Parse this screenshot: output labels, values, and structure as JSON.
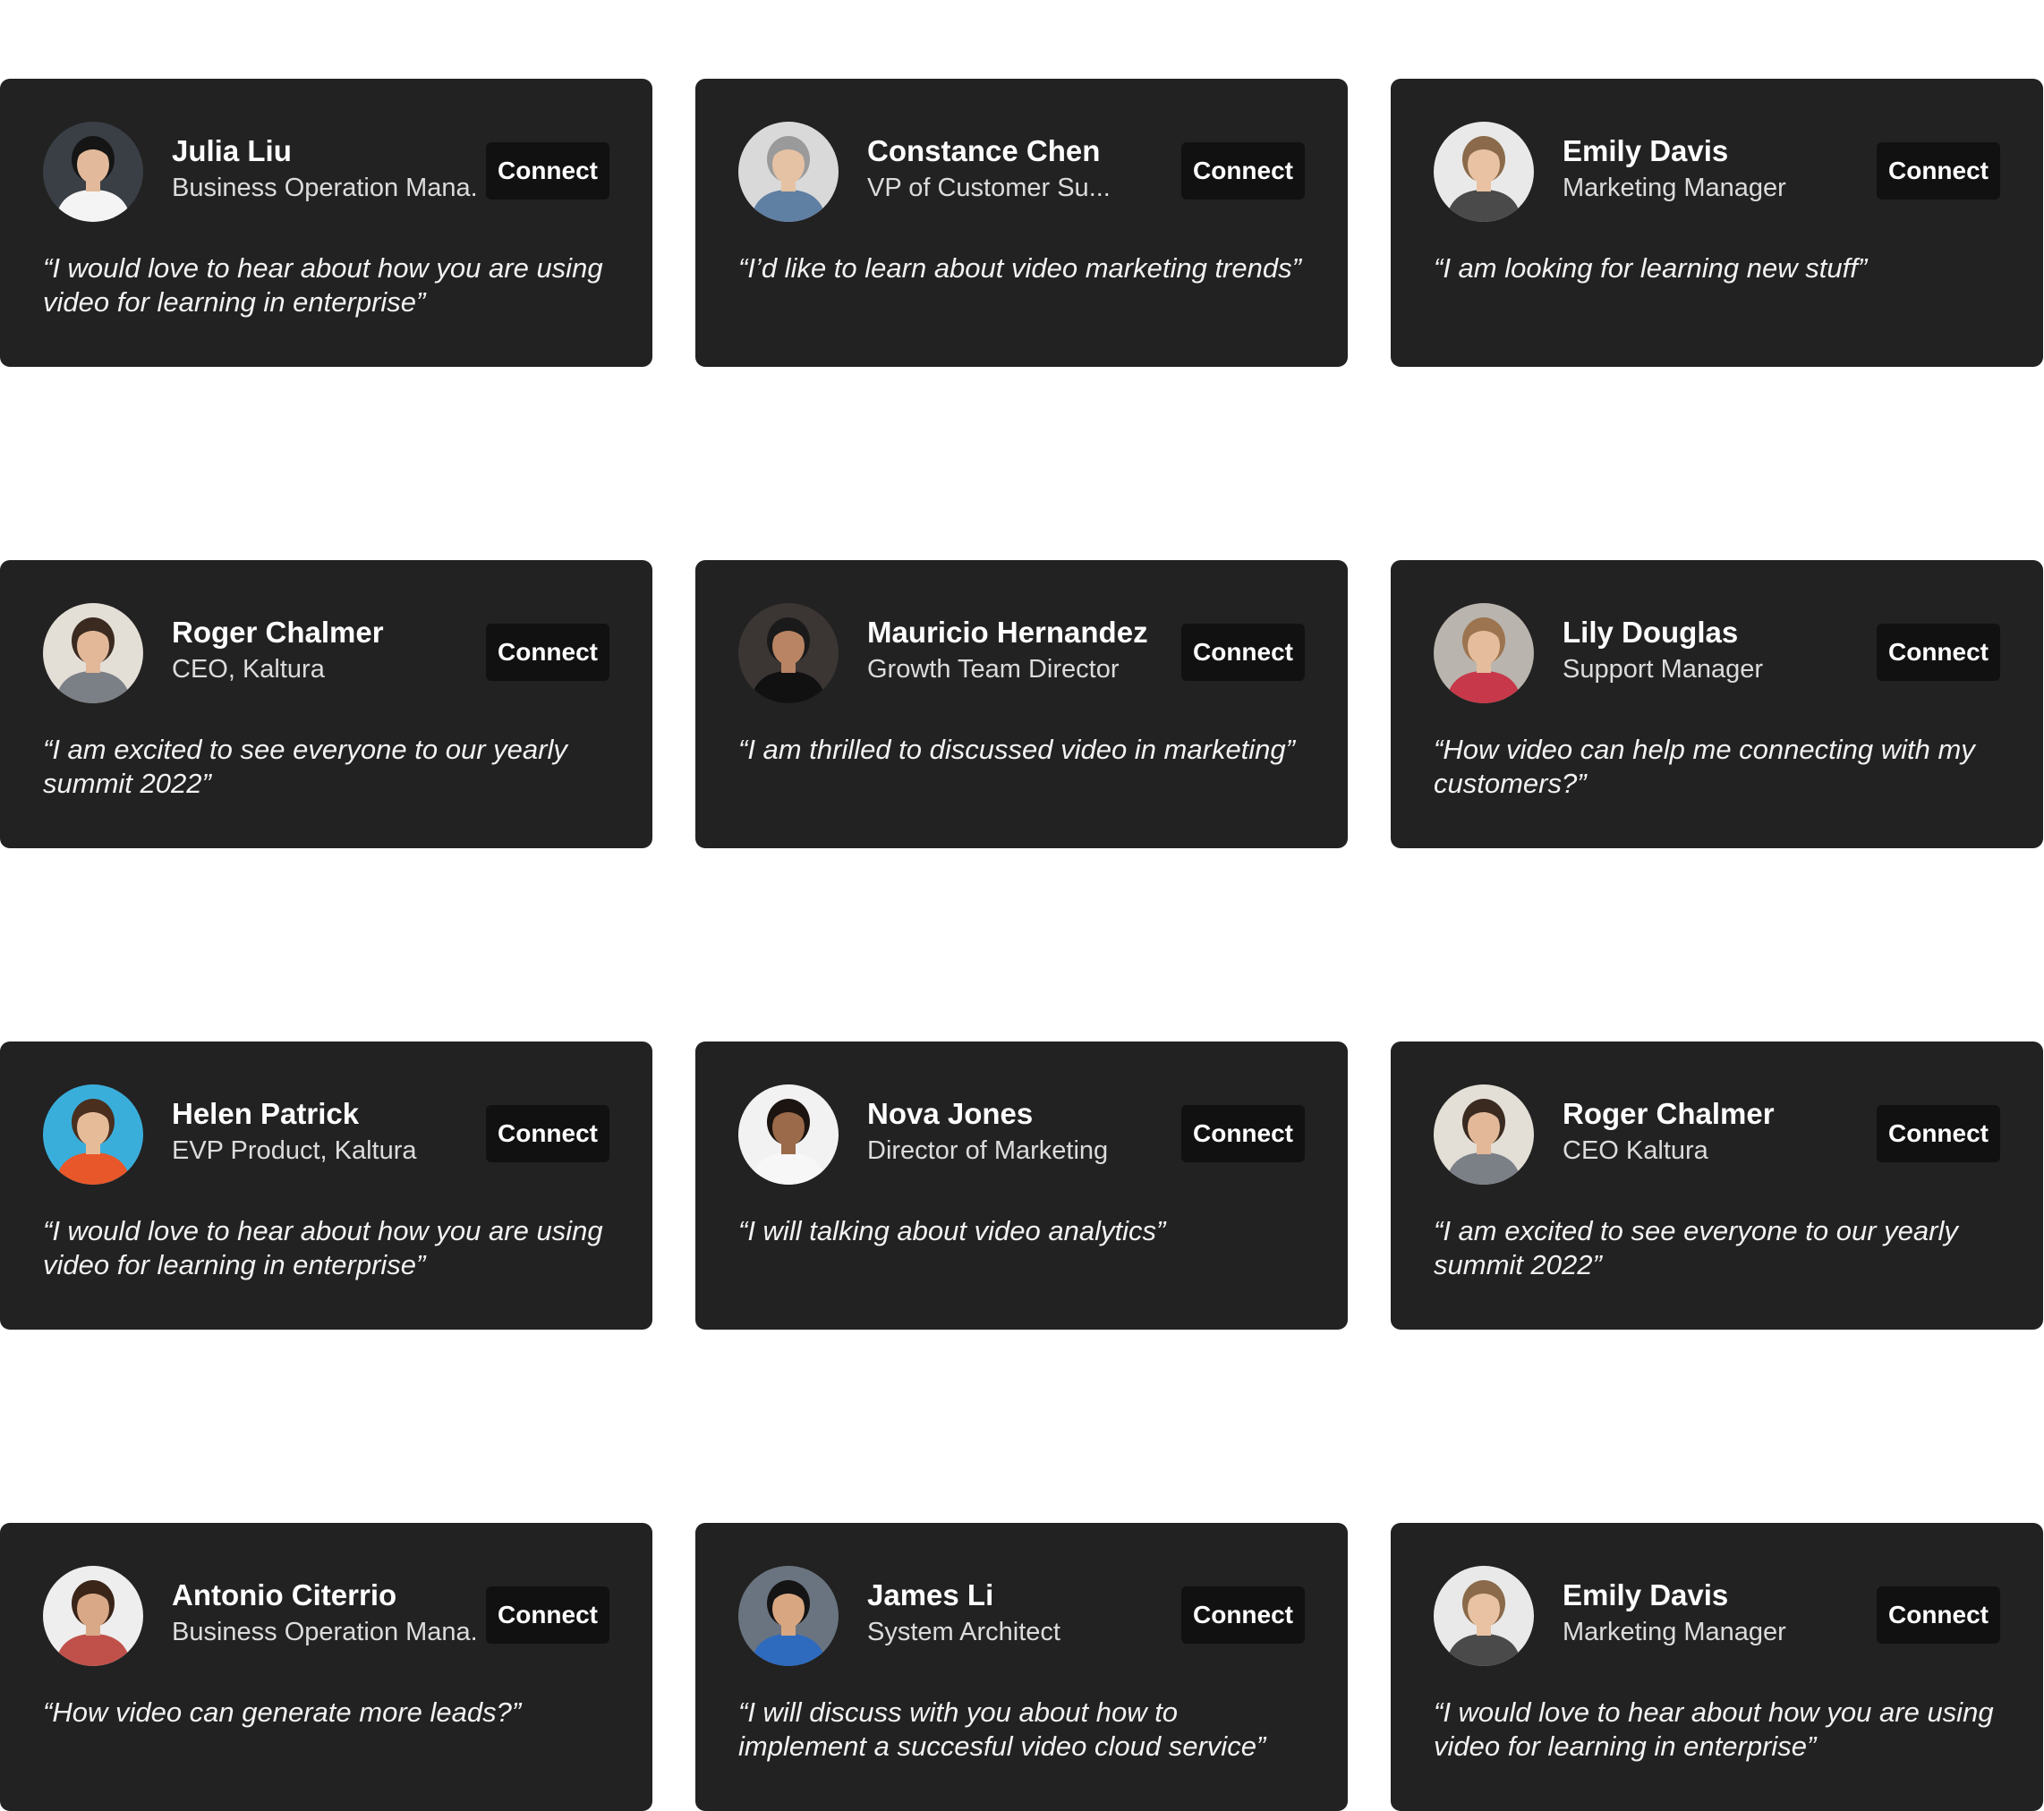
{
  "cards": [
    {
      "name": "Julia Liu",
      "role": "Business Operation Mana...",
      "connect_label": "Connect",
      "quote": "“I would love to hear about how you are using video for learning in enterprise”",
      "avatar": {
        "bg": "#3a3f46",
        "skin": "#e2b99a",
        "hair": "#151515",
        "shirt": "#f4f4f4"
      }
    },
    {
      "name": "Constance Chen",
      "role": "VP of Customer Su...",
      "connect_label": "Connect",
      "quote": "“I’d like to learn about video marketing trends”",
      "avatar": {
        "bg": "#d9d9d9",
        "skin": "#e6c2a4",
        "hair": "#9a9a9a",
        "shirt": "#5f7fa3"
      }
    },
    {
      "name": "Emily Davis",
      "role": "Marketing Manager",
      "connect_label": "Connect",
      "quote": "“I am looking for learning new stuff”",
      "avatar": {
        "bg": "#e9e9e9",
        "skin": "#e8c2a2",
        "hair": "#8a6a4a",
        "shirt": "#4a4a4a"
      }
    },
    {
      "name": "Roger Chalmer",
      "role": "CEO, Kaltura",
      "connect_label": "Connect",
      "quote": "“I am excited to see everyone to our yearly summit 2022”",
      "avatar": {
        "bg": "#e3ded6",
        "skin": "#e3b898",
        "hair": "#3a2a20",
        "shirt": "#7b7f86"
      }
    },
    {
      "name": "Mauricio Hernandez",
      "role": "Growth Team Director",
      "connect_label": "Connect",
      "quote": "“I am thrilled to discussed video in marketing”",
      "avatar": {
        "bg": "#3b3634",
        "skin": "#b98463",
        "hair": "#1a1a1a",
        "shirt": "#111111"
      }
    },
    {
      "name": "Lily Douglas",
      "role": "Support Manager",
      "connect_label": "Connect",
      "quote": "“How video can help me connecting with my customers?”",
      "avatar": {
        "bg": "#b9b4ad",
        "skin": "#e6bd9c",
        "hair": "#9c7450",
        "shirt": "#c7384a"
      }
    },
    {
      "name": "Helen Patrick",
      "role": "EVP Product, Kaltura",
      "connect_label": "Connect",
      "quote": "“I would love to hear about how you are using video for learning in enterprise”",
      "avatar": {
        "bg": "#3aaedb",
        "skin": "#e6bb98",
        "hair": "#4a2e1e",
        "shirt": "#e8572a"
      }
    },
    {
      "name": "Nova Jones",
      "role": "Director of Marketing",
      "connect_label": "Connect",
      "quote": "“I will talking about video analytics”",
      "avatar": {
        "bg": "#f2f2f2",
        "skin": "#9a6a4a",
        "hair": "#1c1410",
        "shirt": "#f7f7f7"
      }
    },
    {
      "name": "Roger Chalmer",
      "role": "CEO Kaltura",
      "connect_label": "Connect",
      "quote": "“I am excited to see everyone to our yearly summit 2022”",
      "avatar": {
        "bg": "#e3ded6",
        "skin": "#e3b898",
        "hair": "#3a2a20",
        "shirt": "#7b7f86"
      }
    },
    {
      "name": "Antonio Citerrio",
      "role": "Business Operation Mana...",
      "connect_label": "Connect",
      "quote": "“How video can generate more leads?”",
      "avatar": {
        "bg": "#eeeeee",
        "skin": "#d9a887",
        "hair": "#3b2418",
        "shirt": "#c0514a"
      }
    },
    {
      "name": "James Li",
      "role": "System Architect",
      "connect_label": "Connect",
      "quote": "“I will discuss with you about how to implement a succesful video cloud service”",
      "avatar": {
        "bg": "#6a7480",
        "skin": "#d8a680",
        "hair": "#141414",
        "shirt": "#2e6bbf"
      }
    },
    {
      "name": "Emily Davis",
      "role": "Marketing Manager",
      "connect_label": "Connect",
      "quote": "“I would love to hear about how you are using video for learning in enterprise”",
      "avatar": {
        "bg": "#e9e9e9",
        "skin": "#e8c2a2",
        "hair": "#8a6a4a",
        "shirt": "#4a4a4a"
      }
    }
  ]
}
